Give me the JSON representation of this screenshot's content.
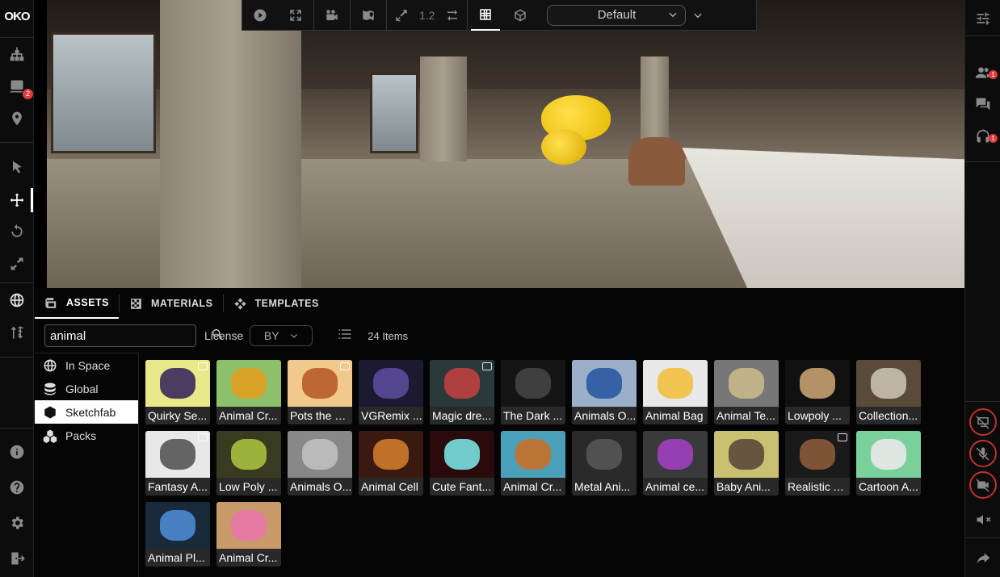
{
  "logo": {
    "text": "OKO"
  },
  "left_bar": {
    "badge_count": "2",
    "icons": [
      "hierarchy-icon",
      "layers-icon",
      "location-pin-icon",
      "select-cursor-icon",
      "move-icon",
      "rotate-icon",
      "scale-icon",
      "globe-icon",
      "sort-icon",
      "info-icon",
      "help-icon",
      "settings-icon",
      "exit-icon"
    ]
  },
  "toolbar": {
    "snap_value": "1.2",
    "view_select": "Default"
  },
  "right_bar": {
    "participants_badge": "1",
    "audio_badge": "1"
  },
  "tabs": [
    {
      "label": "ASSETS",
      "icon": "assets-icon",
      "active": true
    },
    {
      "label": "MATERIALS",
      "icon": "materials-icon",
      "active": false
    },
    {
      "label": "TEMPLATES",
      "icon": "templates-icon",
      "active": false
    }
  ],
  "search": {
    "value": "animal",
    "placeholder": ""
  },
  "license": {
    "label": "License",
    "value": "BY"
  },
  "items_count": "24 Items",
  "nav": [
    {
      "label": "In Space",
      "icon": "globe-icon",
      "active": false
    },
    {
      "label": "Global",
      "icon": "database-icon",
      "active": false
    },
    {
      "label": "Sketchfab",
      "icon": "cube-icon",
      "active": true
    },
    {
      "label": "Packs",
      "icon": "packs-icon",
      "active": false
    }
  ],
  "assets": [
    {
      "label": "Quirky Se...",
      "bg": "#e9e98a",
      "fg": "#3a2a5a",
      "animated": true
    },
    {
      "label": "Animal Cr...",
      "bg": "#8cc06a",
      "fg": "#e0a020",
      "animated": false
    },
    {
      "label": "Pots the R...",
      "bg": "#f2c98c",
      "fg": "#b85c2a",
      "animated": true
    },
    {
      "label": "VGRemix ...",
      "bg": "#1a1a30",
      "fg": "#5a4a9a",
      "animated": false
    },
    {
      "label": "Magic dre...",
      "bg": "#2a3a3a",
      "fg": "#c04040",
      "animated": true
    },
    {
      "label": "The Dark ...",
      "bg": "#151515",
      "fg": "#444",
      "animated": false
    },
    {
      "label": "Animals O...",
      "bg": "#9ab0c8",
      "fg": "#2a5aa0",
      "animated": false
    },
    {
      "label": "Animal Bag",
      "bg": "#e8e8e8",
      "fg": "#f0c040",
      "animated": false
    },
    {
      "label": "Animal Te...",
      "bg": "#777",
      "fg": "#c8b888",
      "animated": false
    },
    {
      "label": "Lowpoly ...",
      "bg": "#111",
      "fg": "#c8a070",
      "animated": false
    },
    {
      "label": "Collection...",
      "bg": "#5a4a3a",
      "fg": "#c8c0b0",
      "animated": false
    },
    {
      "label": "Fantasy A...",
      "bg": "#e8e8e8",
      "fg": "#555",
      "animated": true
    },
    {
      "label": "Low Poly ...",
      "bg": "#3a3a20",
      "fg": "#a8c040",
      "animated": false
    },
    {
      "label": "Animals O...",
      "bg": "#888",
      "fg": "#c0c0c0",
      "animated": false
    },
    {
      "label": "Animal Cell",
      "bg": "#3a1a10",
      "fg": "#d07a2a",
      "animated": false
    },
    {
      "label": "Cute Fant...",
      "bg": "#2a0a0a",
      "fg": "#7ae0e0",
      "animated": false
    },
    {
      "label": "Animal Cr...",
      "bg": "#4aa0b8",
      "fg": "#c8702a",
      "animated": false
    },
    {
      "label": "Metal Ani...",
      "bg": "#2a2a2a",
      "fg": "#555",
      "animated": false
    },
    {
      "label": "Animal ce...",
      "bg": "#3a3a3a",
      "fg": "#a040c0",
      "animated": false
    },
    {
      "label": "Baby Ani...",
      "bg": "#c8c070",
      "fg": "#5a4a3a",
      "animated": false
    },
    {
      "label": "Realistic A...",
      "bg": "#1a1a1a",
      "fg": "#8a5a3a",
      "animated": true
    },
    {
      "label": "Cartoon A...",
      "bg": "#7ad09a",
      "fg": "#e8e8e8",
      "animated": false
    },
    {
      "label": "Animal Pl...",
      "bg": "#1a2a3a",
      "fg": "#4a8ad0",
      "animated": false
    },
    {
      "label": "Animal Cr...",
      "bg": "#c89a6a",
      "fg": "#e878a8",
      "animated": false
    }
  ]
}
